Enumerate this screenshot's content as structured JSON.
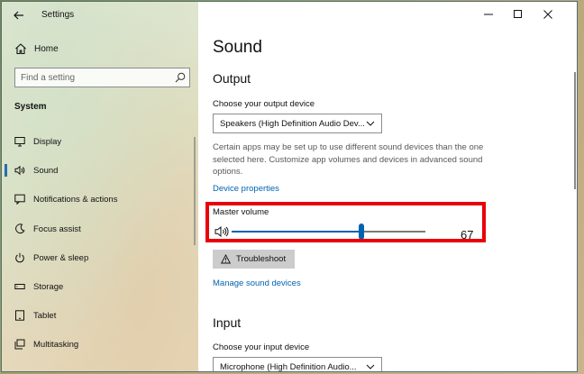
{
  "window": {
    "title": "Settings",
    "back_icon": "arrow-left-icon",
    "minimize_icon": "minimize-icon",
    "maximize_icon": "maximize-icon",
    "close_icon": "close-icon"
  },
  "sidebar": {
    "home_label": "Home",
    "search": {
      "placeholder": "Find a setting",
      "icon": "search-icon"
    },
    "section_label": "System",
    "items": [
      {
        "label": "Display",
        "icon": "monitor-icon",
        "active": false
      },
      {
        "label": "Sound",
        "icon": "speaker-icon",
        "active": true
      },
      {
        "label": "Notifications & actions",
        "icon": "message-icon",
        "active": false
      },
      {
        "label": "Focus assist",
        "icon": "moon-icon",
        "active": false
      },
      {
        "label": "Power & sleep",
        "icon": "power-icon",
        "active": false
      },
      {
        "label": "Storage",
        "icon": "storage-icon",
        "active": false
      },
      {
        "label": "Tablet",
        "icon": "tablet-icon",
        "active": false
      },
      {
        "label": "Multitasking",
        "icon": "multitasking-icon",
        "active": false
      }
    ]
  },
  "main": {
    "title": "Sound",
    "output": {
      "heading": "Output",
      "device_label": "Choose your output device",
      "device_value": "Speakers (High Definition Audio Dev...",
      "description": "Certain apps may be set up to use different sound devices than the one selected here. Customize app volumes and devices in advanced sound options.",
      "device_properties_link": "Device properties",
      "master_volume_label": "Master volume",
      "master_volume_value": "67",
      "volume_fraction": 0.67,
      "troubleshoot_label": "Troubleshoot",
      "manage_devices_link": "Manage sound devices"
    },
    "input": {
      "heading": "Input",
      "device_label": "Choose your input device",
      "device_value": "Microphone (High Definition Audio..."
    }
  },
  "colors": {
    "accent": "#0063b1",
    "highlight": "#e8000b",
    "link": "#0063b1"
  }
}
